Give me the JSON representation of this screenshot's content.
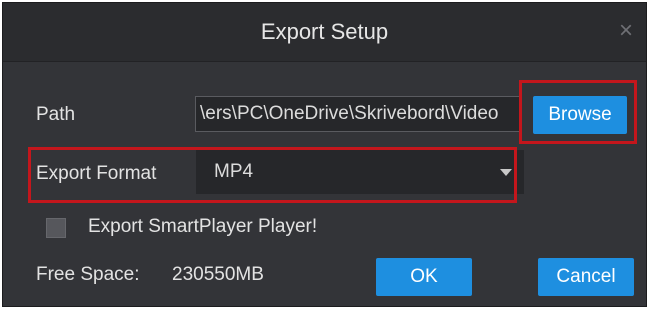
{
  "dialog": {
    "title": "Export Setup",
    "close_glyph": "×"
  },
  "path": {
    "label": "Path",
    "value": "ers\\PC\\OneDrive\\Skrivebord\\Video\\",
    "browse_label": "Browse"
  },
  "format": {
    "label": "Export Format",
    "selected": "MP4"
  },
  "smartplayer": {
    "label": "Export SmartPlayer Player!",
    "checked": false
  },
  "free_space": {
    "label": "Free Space:",
    "value": "230550MB"
  },
  "buttons": {
    "ok_label": "OK",
    "cancel_label": "Cancel"
  },
  "colors": {
    "dialog_bg": "#333438",
    "titlebar_bg": "#2b2c2f",
    "accent": "#1e8fe0",
    "highlight": "#c4161c"
  }
}
